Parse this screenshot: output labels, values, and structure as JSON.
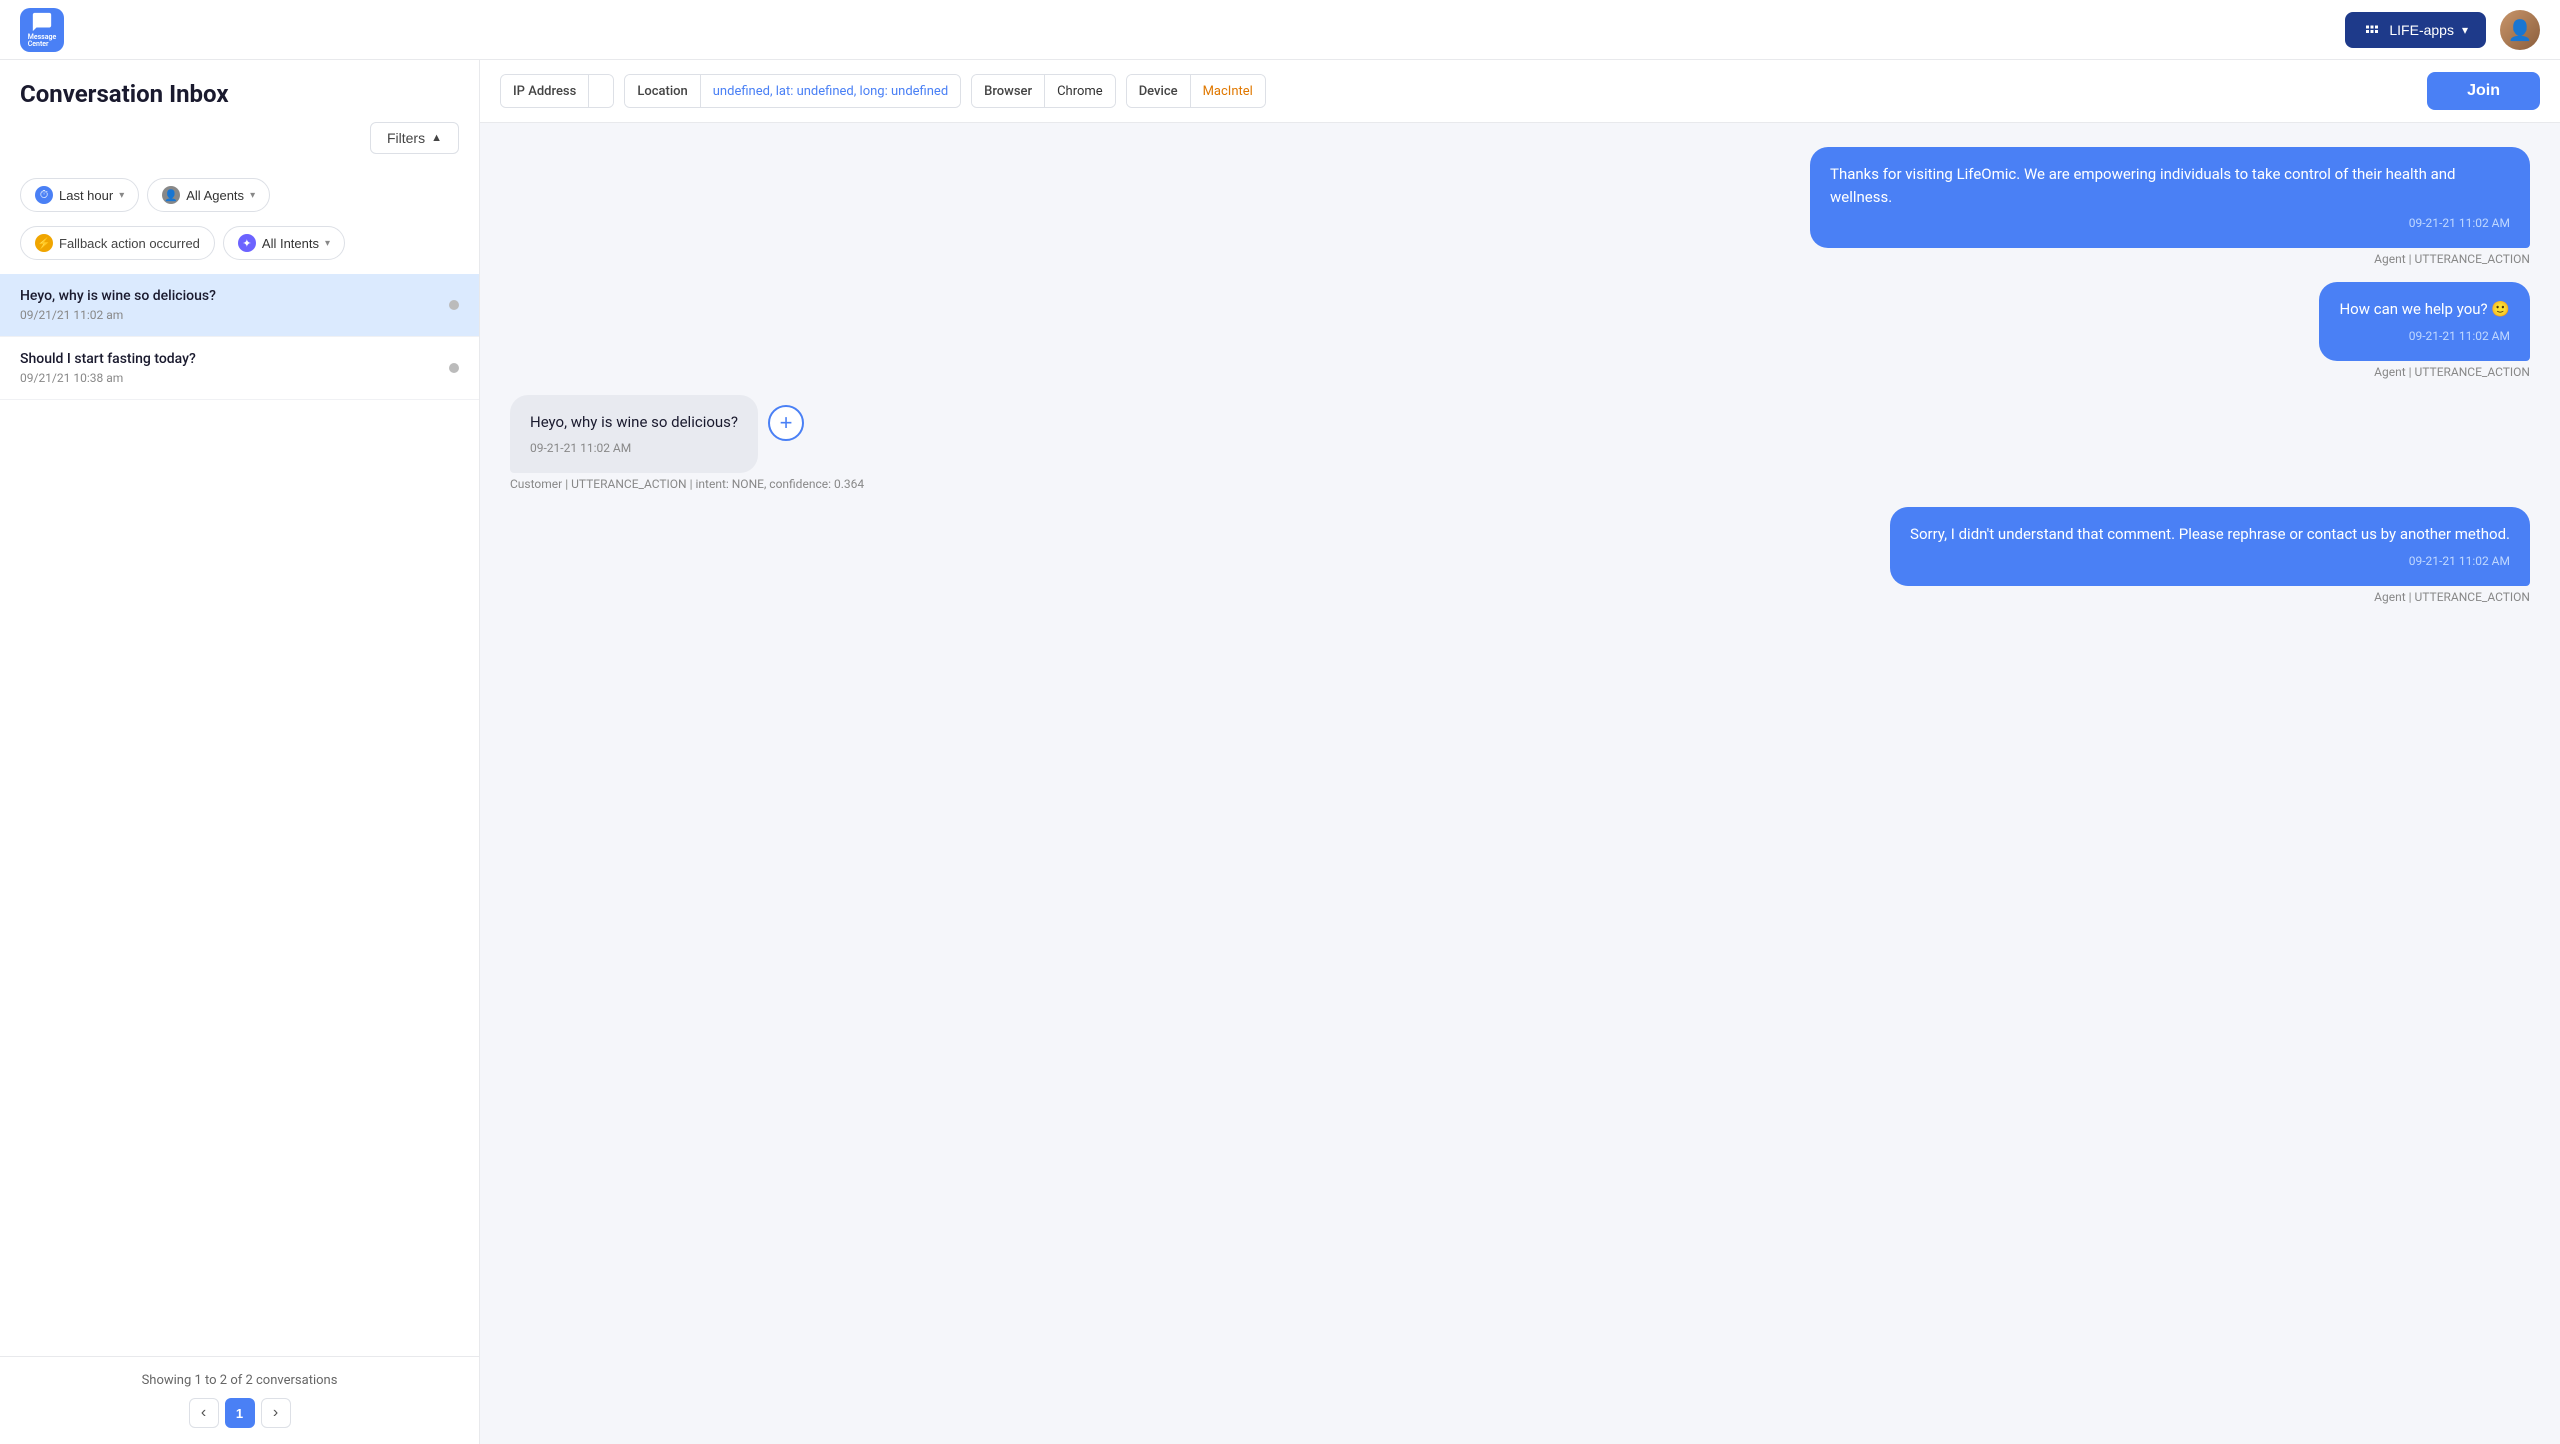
{
  "topnav": {
    "app_name": "Message\nCenter",
    "life_apps_label": "LIFE-apps",
    "chevron": "▾"
  },
  "sidebar": {
    "title": "Conversation Inbox",
    "filters_label": "Filters",
    "time_filter": {
      "label": "Last hour",
      "chevron": "▾"
    },
    "agents_filter": {
      "label": "All Agents",
      "chevron": "▾"
    },
    "fallback_filter": {
      "label": "Fallback action occurred"
    },
    "intents_filter": {
      "label": "All Intents",
      "chevron": "▾"
    },
    "conversations": [
      {
        "id": "c1",
        "message": "Heyo, why is wine so delicious?",
        "timestamp": "09/21/21 11:02 am",
        "active": true
      },
      {
        "id": "c2",
        "message": "Should I start fasting today?",
        "timestamp": "09/21/21 10:38 am",
        "active": false
      }
    ],
    "pagination": {
      "text": "Showing 1 to 2 of 2 conversations",
      "prev": "‹",
      "current_page": "1",
      "next": "›"
    }
  },
  "detail": {
    "meta_tags": [
      {
        "label": "IP Address",
        "value": ""
      },
      {
        "label": "Location",
        "value": "undefined, lat: undefined, long: undefined",
        "color": "blue"
      },
      {
        "label": "Browser",
        "value": "Chrome"
      },
      {
        "label": "Device",
        "value": "MacIntel",
        "color": "orange"
      }
    ],
    "join_btn": "Join"
  },
  "chat": {
    "messages": [
      {
        "id": "m1",
        "type": "agent",
        "text": "Thanks for visiting LifeOmic. We are empowering individuals to take control of their health and wellness.",
        "time": "09-21-21 11:02 AM",
        "attribution": "Agent | UTTERANCE_ACTION"
      },
      {
        "id": "m2",
        "type": "agent",
        "text": "How can we help you? 🙂",
        "time": "09-21-21 11:02 AM",
        "attribution": "Agent | UTTERANCE_ACTION"
      },
      {
        "id": "m3",
        "type": "customer",
        "text": "Heyo, why is wine so delicious?",
        "time": "09-21-21 11:02 AM",
        "attribution": "Customer | UTTERANCE_ACTION | intent: NONE, confidence: 0.364"
      },
      {
        "id": "m4",
        "type": "agent",
        "text": "Sorry, I didn't understand that comment. Please rephrase or contact us by another method.",
        "time": "09-21-21 11:02 AM",
        "attribution": "Agent | UTTERANCE_ACTION"
      }
    ]
  }
}
